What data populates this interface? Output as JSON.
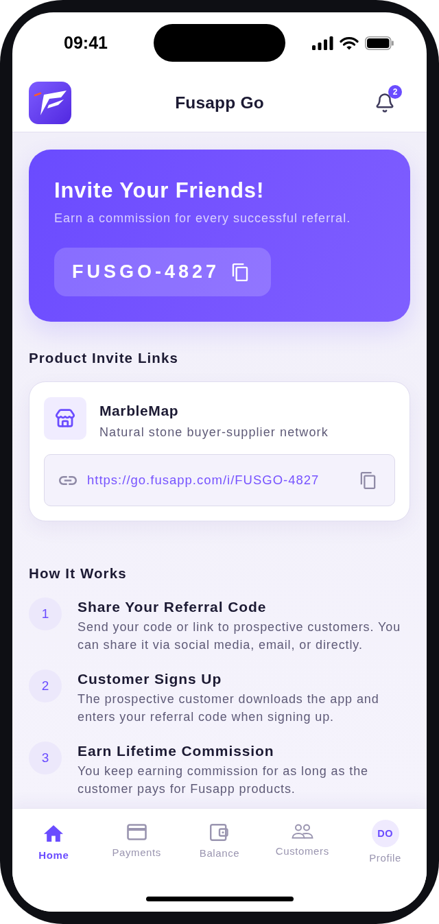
{
  "status_bar": {
    "time": "09:41"
  },
  "header": {
    "title": "Fusapp Go",
    "notification_count": "2"
  },
  "invite_card": {
    "title": "Invite Your Friends!",
    "subtitle": "Earn a commission for every successful referral.",
    "code": "FUSGO-4827"
  },
  "product_invite_links": {
    "heading": "Product Invite Links",
    "items": [
      {
        "name": "MarbleMap",
        "description": "Natural stone buyer-supplier network",
        "url": "https://go.fusapp.com/i/FUSGO-4827"
      }
    ]
  },
  "how_it_works": {
    "heading": "How It Works",
    "steps": [
      {
        "number": "1",
        "title": "Share Your Referral Code",
        "description": "Send your code or link to prospective customers. You can share it via social media, email, or directly."
      },
      {
        "number": "2",
        "title": "Customer Signs Up",
        "description": "The prospective customer downloads the app and enters your referral code when signing up."
      },
      {
        "number": "3",
        "title": "Earn Lifetime Commission",
        "description": "You keep earning commission for as long as the customer pays for Fusapp products."
      }
    ]
  },
  "bottom_nav": {
    "items": [
      {
        "kind": "icon",
        "label": "Home",
        "selected": true
      },
      {
        "kind": "icon",
        "label": "Payments",
        "selected": false
      },
      {
        "kind": "icon",
        "label": "Balance",
        "selected": false
      },
      {
        "kind": "icon",
        "label": "Customers",
        "selected": false
      },
      {
        "kind": "avatar",
        "initials": "DO",
        "label": "Profile",
        "selected": false
      }
    ]
  }
}
